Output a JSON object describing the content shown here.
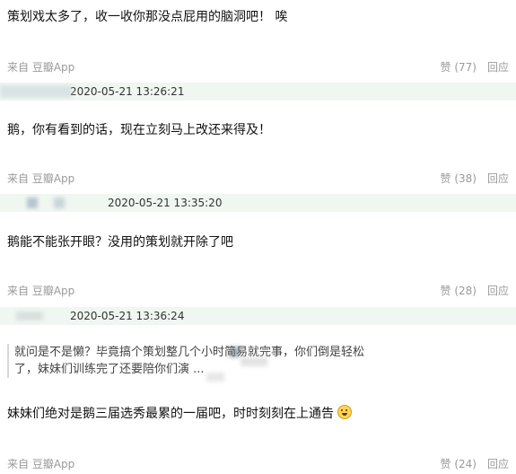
{
  "c0": {
    "content": "策划戏太多了，收一收你那没点屁用的脑洞吧！ 唉",
    "source": "来自 豆瓣App",
    "like": "赞 (77)",
    "reply": "回应"
  },
  "c1": {
    "timestamp": "2020-05-21 13:26:21",
    "content": "鹅，你有看到的话，现在立刻马上改还来得及！",
    "source": "来自 豆瓣App",
    "like": "赞 (38)",
    "reply": "回应"
  },
  "c2": {
    "timestamp": "2020-05-21 13:35:20",
    "content": "鹅能不能张开眼？没用的策划就开除了吧",
    "source": "来自 豆瓣App",
    "like": "赞 (28)",
    "reply": "回应"
  },
  "c3": {
    "timestamp": "2020-05-21 13:36:24",
    "quote_line1": "就问是不是懒？毕竟搞个策划整几个小时简易就完事，你们倒是轻松",
    "quote_line2": "了，妹妹们训练完了还要陪你们演 ...",
    "content": "妹妹们绝对是鹅三届选秀最累的一届吧，时时刻刻在上通告",
    "source": "来自 豆瓣App",
    "like": "赞 (24)",
    "reply": "回应"
  }
}
